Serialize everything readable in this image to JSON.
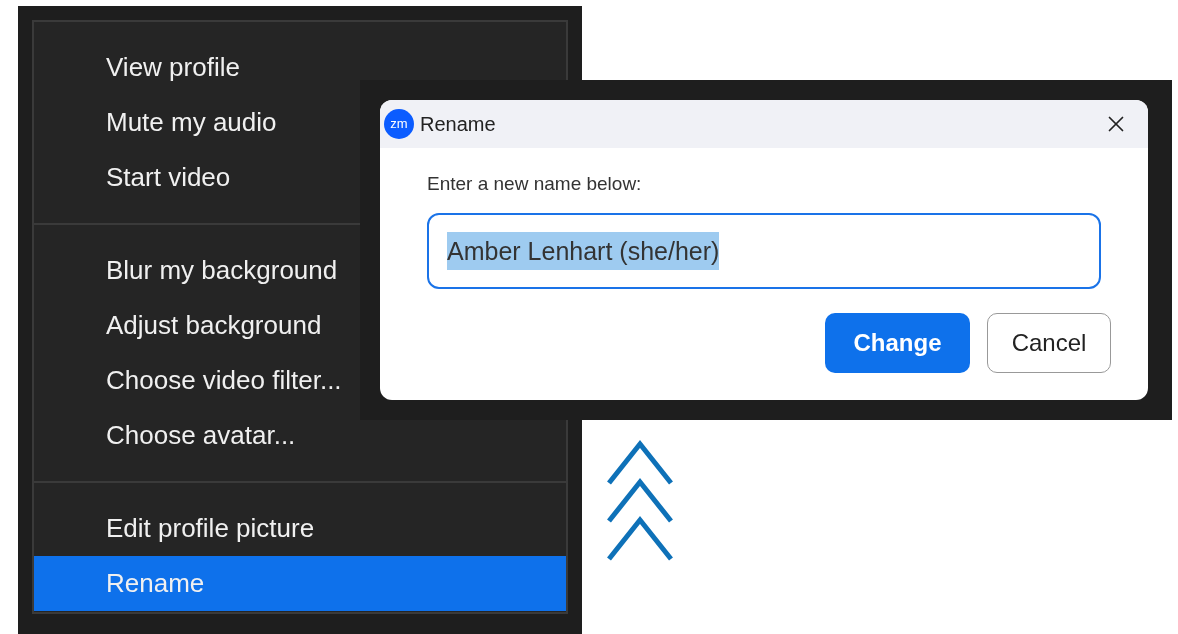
{
  "menu": {
    "sections": [
      {
        "items": [
          {
            "label": "View profile",
            "selected": false
          },
          {
            "label": "Mute my audio",
            "selected": false
          },
          {
            "label": "Start video",
            "selected": false
          }
        ]
      },
      {
        "items": [
          {
            "label": "Blur my background",
            "selected": false
          },
          {
            "label": "Adjust background",
            "selected": false
          },
          {
            "label": "Choose video filter...",
            "selected": false
          },
          {
            "label": "Choose avatar...",
            "selected": false
          }
        ]
      },
      {
        "items": [
          {
            "label": "Edit profile picture",
            "selected": false
          },
          {
            "label": "Rename",
            "selected": true
          }
        ]
      }
    ]
  },
  "dialog": {
    "logo": "zm",
    "title": "Rename",
    "prompt": "Enter a new name below:",
    "field": {
      "value": "Amber Lenhart (she/her)",
      "text_selected": true,
      "focused": true
    },
    "buttons": [
      {
        "label": "Change",
        "kind": "primary"
      },
      {
        "label": "Cancel",
        "kind": "secondary"
      }
    ]
  }
}
